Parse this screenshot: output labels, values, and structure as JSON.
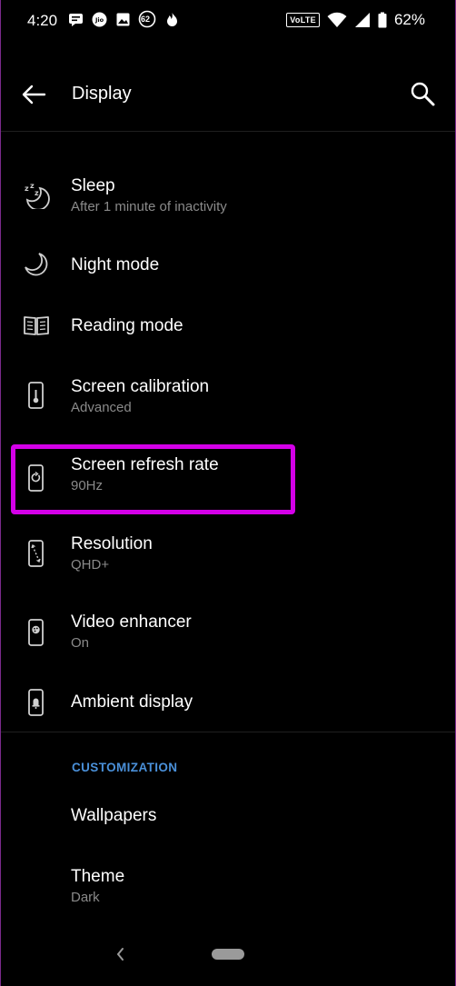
{
  "status_bar": {
    "time": "4:20",
    "notification_badge": "62",
    "network_label": "VoLTE",
    "battery": "62%"
  },
  "header": {
    "title": "Display",
    "back_icon": "arrow-left-icon",
    "search_icon": "search-icon"
  },
  "items": [
    {
      "title": "Sleep",
      "subtitle": "After 1 minute of inactivity",
      "icon": "sleep-icon"
    },
    {
      "title": "Night mode",
      "subtitle": "",
      "icon": "moon-icon"
    },
    {
      "title": "Reading mode",
      "subtitle": "",
      "icon": "book-icon"
    },
    {
      "title": "Screen calibration",
      "subtitle": "Advanced",
      "icon": "thermometer-phone-icon"
    },
    {
      "title": "Screen refresh rate",
      "subtitle": "90Hz",
      "icon": "refresh-phone-icon"
    },
    {
      "title": "Resolution",
      "subtitle": "QHD+",
      "icon": "resolution-phone-icon"
    },
    {
      "title": "Video enhancer",
      "subtitle": "On",
      "icon": "palette-phone-icon"
    },
    {
      "title": "Ambient display",
      "subtitle": "",
      "icon": "bell-phone-icon"
    }
  ],
  "customization": {
    "section_label": "CUSTOMIZATION",
    "items": [
      {
        "title": "Wallpapers",
        "subtitle": ""
      },
      {
        "title": "Theme",
        "subtitle": "Dark"
      }
    ]
  },
  "colors": {
    "background": "#000000",
    "highlight": "#d400e8",
    "section_accent": "#4a90d9",
    "subtitle": "#8a8a8a"
  }
}
